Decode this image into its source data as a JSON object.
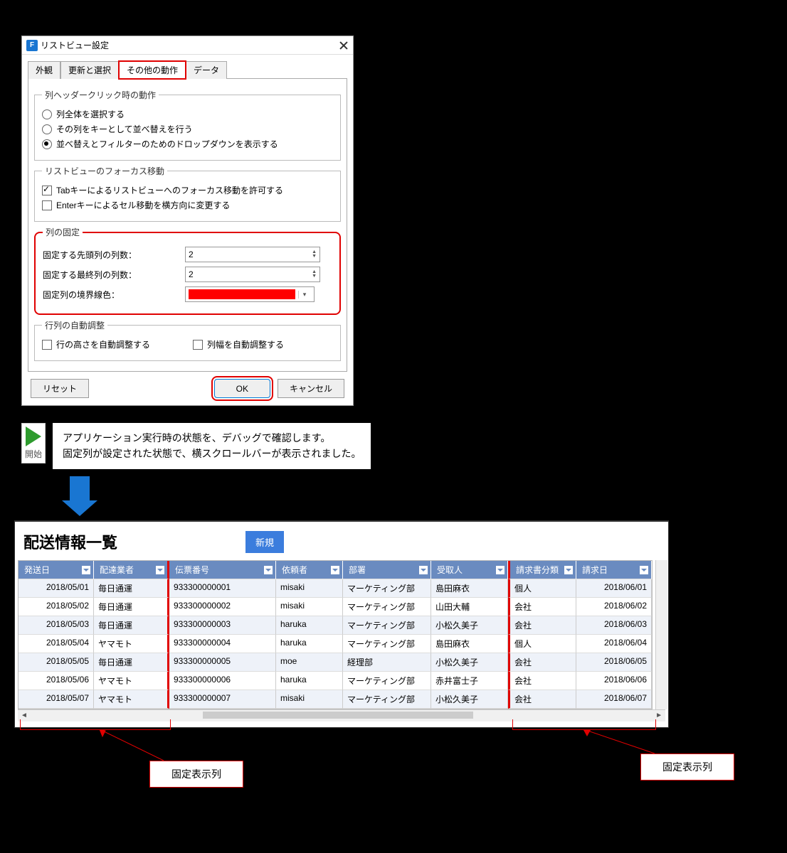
{
  "dialog": {
    "title": "リストビュー設定",
    "tabs": [
      "外観",
      "更新と選択",
      "その他の動作",
      "データ"
    ],
    "active_tab_index": 2,
    "groups": {
      "header_click": {
        "legend": "列ヘッダークリック時の動作",
        "options": [
          "列全体を選択する",
          "その列をキーとして並べ替えを行う",
          "並べ替えとフィルターのためのドロップダウンを表示する"
        ],
        "selected_index": 2
      },
      "focus_move": {
        "legend": "リストビューのフォーカス移動",
        "options": [
          "Tabキーによるリストビューへのフォーカス移動を許可する",
          "Enterキーによるセル移動を横方向に変更する"
        ],
        "checked": [
          true,
          false
        ]
      },
      "column_fix": {
        "legend": "列の固定",
        "leading_label": "固定する先頭列の列数：",
        "leading_value": "2",
        "trailing_label": "固定する最終列の列数：",
        "trailing_value": "2",
        "border_color_label": "固定列の境界線色：",
        "border_color": "#ff0000"
      },
      "auto_adjust": {
        "legend": "行列の自動調整",
        "row_height_label": "行の高さを自動調整する",
        "row_height_checked": false,
        "col_width_label": "列幅を自動調整する",
        "col_width_checked": false
      }
    },
    "buttons": {
      "reset": "リセット",
      "ok": "OK",
      "cancel": "キャンセル"
    }
  },
  "info": {
    "start_label": "開始",
    "line1": "アプリケーション実行時の状態を、デバッグで確認します。",
    "line2": "固定列が設定された状態で、横スクロールバーが表示されました。"
  },
  "result": {
    "title": "配送情報一覧",
    "new_button": "新規",
    "columns": [
      "発送日",
      "配達業者",
      "伝票番号",
      "依頼者",
      "部署",
      "受取人",
      "請求書分類",
      "請求日"
    ],
    "rows": [
      [
        "2018/05/01",
        "毎日通運",
        "933300000001",
        "misaki",
        "マーケティング部",
        "島田麻衣",
        "個人",
        "2018/06/01"
      ],
      [
        "2018/05/02",
        "毎日通運",
        "933300000002",
        "misaki",
        "マーケティング部",
        "山田大輔",
        "会社",
        "2018/06/02"
      ],
      [
        "2018/05/03",
        "毎日通運",
        "933300000003",
        "haruka",
        "マーケティング部",
        "小松久美子",
        "会社",
        "2018/06/03"
      ],
      [
        "2018/05/04",
        "ヤマモト",
        "933300000004",
        "haruka",
        "マーケティング部",
        "島田麻衣",
        "個人",
        "2018/06/04"
      ],
      [
        "2018/05/05",
        "毎日通運",
        "933300000005",
        "moe",
        "経理部",
        "小松久美子",
        "会社",
        "2018/06/05"
      ],
      [
        "2018/05/06",
        "ヤマモト",
        "933300000006",
        "haruka",
        "マーケティング部",
        "赤井富士子",
        "会社",
        "2018/06/06"
      ],
      [
        "2018/05/07",
        "ヤマモト",
        "933300000007",
        "misaki",
        "マーケティング部",
        "小松久美子",
        "会社",
        "2018/06/07"
      ]
    ]
  },
  "callout": {
    "label": "固定表示列"
  }
}
